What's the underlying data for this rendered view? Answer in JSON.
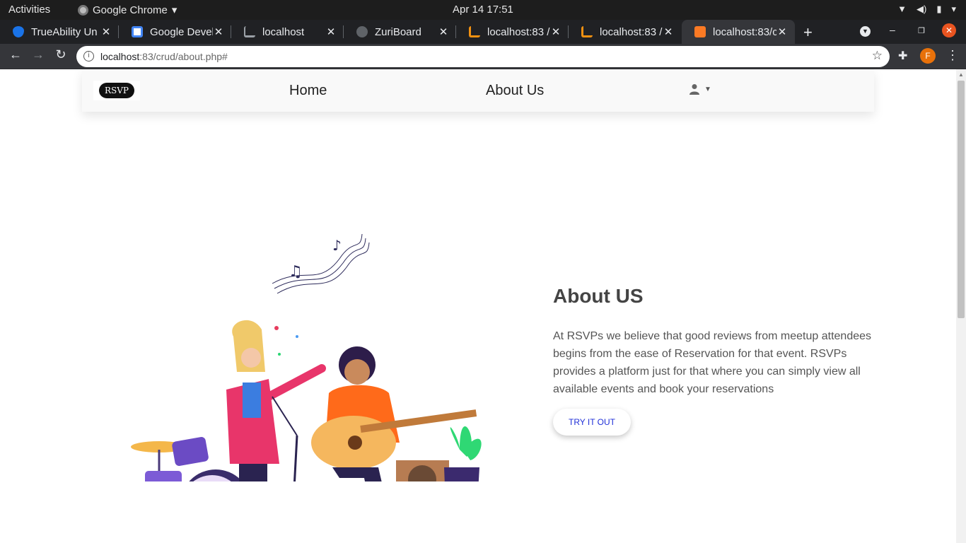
{
  "system_bar": {
    "activities": "Activities",
    "app_name": "Google Chrome",
    "clock": "Apr 14  17:51"
  },
  "browser": {
    "tabs": [
      {
        "title": "TrueAbility Un",
        "favicon_color": "#1a73e8"
      },
      {
        "title": "Google Develo",
        "favicon_color": "#ffffff"
      },
      {
        "title": "localhost",
        "favicon_color": "#9aa0a6"
      },
      {
        "title": "ZuriBoard",
        "favicon_color": "#9aa0a6"
      },
      {
        "title": "localhost:83 /",
        "favicon_color": "#f29111"
      },
      {
        "title": "localhost:83 /",
        "favicon_color": "#f29111"
      },
      {
        "title": "localhost:83/c",
        "favicon_color": "#fb7a24"
      }
    ],
    "url_host": "localhost",
    "url_rest": ":83/crud/about.php#",
    "profile_initial": "F"
  },
  "site": {
    "logo_text": "RSVP",
    "nav": {
      "home": "Home",
      "about": "About Us"
    },
    "about": {
      "title": "About US",
      "body": "At RSVPs we believe that good reviews from meetup attendees begins from the ease of Reservation for that event. RSVPs provides a platform just for that where you can simply view all available events and book your reservations",
      "cta": "TRY IT OUT"
    }
  },
  "colors": {
    "cta_text": "#1f2fd8",
    "chrome_dark": "#202124",
    "profile": "#e8710a"
  }
}
